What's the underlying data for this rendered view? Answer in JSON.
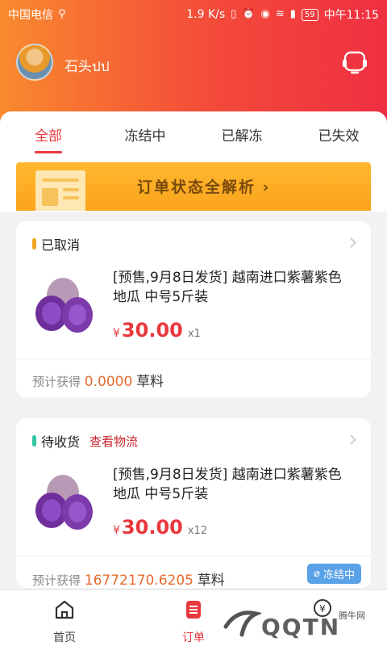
{
  "statusbar": {
    "carrier": "中国电信",
    "usb_icon": "usb-icon",
    "speed": "1.9 K/s",
    "battery": "59",
    "time": "中午11:15"
  },
  "profile": {
    "username": "石头ปป"
  },
  "tabs": [
    {
      "label": "全部",
      "active": true
    },
    {
      "label": "冻结中",
      "active": false
    },
    {
      "label": "已解冻",
      "active": false
    },
    {
      "label": "已失效",
      "active": false
    }
  ],
  "banner": {
    "text": "订单状态全解析 ›"
  },
  "orders": [
    {
      "status": "已取消",
      "status_color": "#f5a623",
      "title": "[预售,9月8日发货] 越南进口紫薯紫色地瓜  中号5斤装",
      "currency": "¥",
      "price": "30.00",
      "qty": "x1",
      "earn_label": "预计获得",
      "earn_value": "0.0000",
      "earn_unit": "草料"
    },
    {
      "status": "待收货",
      "status_color": "#34c6a4",
      "logistics": "查看物流",
      "title": "[预售,9月8日发货] 越南进口紫薯紫色地瓜  中号5斤装",
      "currency": "¥",
      "price": "30.00",
      "qty": "x12",
      "earn_label": "预计获得",
      "earn_value": "16772170.6205",
      "earn_unit": "草料",
      "badge": "冻结中"
    }
  ],
  "bottom_nav": [
    {
      "label": "首页",
      "icon": "home-icon",
      "active": false
    },
    {
      "label": "订单",
      "icon": "order-icon",
      "active": true
    },
    {
      "label": "",
      "icon": "yen-wallet-icon",
      "active": false
    }
  ],
  "watermark": {
    "text": "QQTN",
    "sub": "腾牛网"
  },
  "colors": {
    "accent": "#e8383d",
    "header_start": "#f98a2e",
    "header_end": "#ef2f41",
    "badge": "#5aa2e8"
  }
}
